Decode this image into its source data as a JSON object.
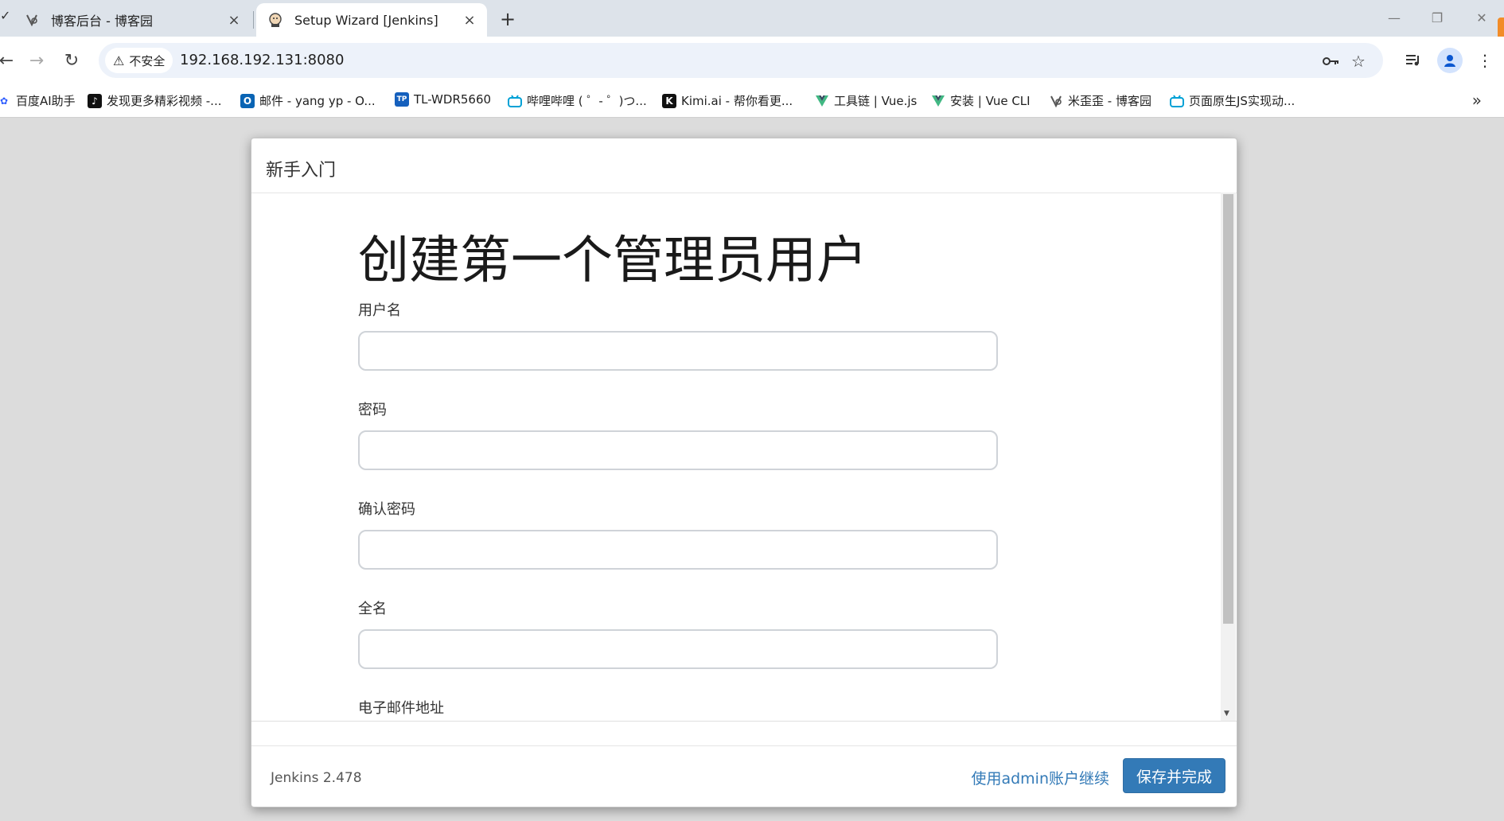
{
  "tabs": [
    {
      "title": "博客后台 - 博客园",
      "close": "×"
    },
    {
      "title": "Setup Wizard [Jenkins]",
      "close": "×"
    }
  ],
  "new_tab_label": "+",
  "address_bar": {
    "security_label": "不安全",
    "url": "192.168.192.131:8080"
  },
  "bookmarks": [
    {
      "label": "百度AI助手",
      "icon": "baidu-icon"
    },
    {
      "label": "发现更多精彩视频 -...",
      "icon": "tiktok-icon"
    },
    {
      "label": "邮件 - yang yp - O...",
      "icon": "outlook-icon"
    },
    {
      "label": "TL-WDR5660",
      "icon": "tplink-icon"
    },
    {
      "label": "哔哩哔哩 ( ゜- ゜)つ...",
      "icon": "bilibili-icon"
    },
    {
      "label": "Kimi.ai - 帮你看更...",
      "icon": "kimi-icon"
    },
    {
      "label": "工具链 | Vue.js",
      "icon": "vue-icon"
    },
    {
      "label": "安装 | Vue CLI",
      "icon": "vue-icon"
    },
    {
      "label": "米歪歪 - 博客园",
      "icon": "cnblogs-icon"
    },
    {
      "label": "页面原生JS实现动...",
      "icon": "bilibili-icon"
    }
  ],
  "dialog": {
    "header_title": "新手入门",
    "heading": "创建第一个管理员用户",
    "fields": [
      {
        "label": "用户名",
        "value": ""
      },
      {
        "label": "密码",
        "value": ""
      },
      {
        "label": "确认密码",
        "value": ""
      },
      {
        "label": "全名",
        "value": ""
      },
      {
        "label": "电子邮件地址",
        "value": ""
      }
    ],
    "footer": {
      "version": "Jenkins 2.478",
      "continue_as_admin": "使用admin账户继续",
      "save_and_finish": "保存并完成"
    }
  },
  "colors": {
    "primary": "#337ab7",
    "link": "#337ab7",
    "page_bg": "#dcdcdc"
  }
}
